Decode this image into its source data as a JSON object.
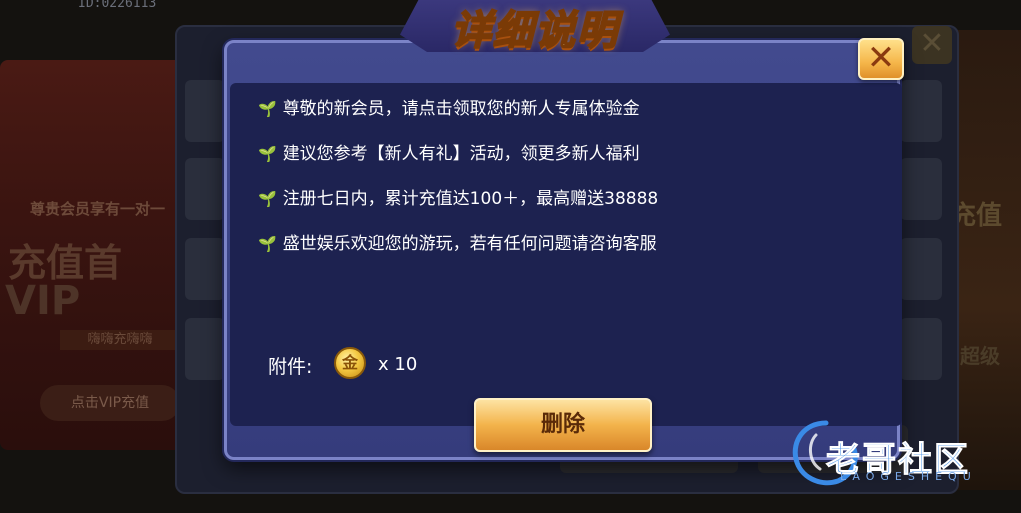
{
  "background": {
    "user_id": "ID:0226113",
    "left_tagline": "尊贵会员享有一对一",
    "left_title": "充值首",
    "left_vip": "VIP",
    "left_strip": "嗨嗨充嗨嗨",
    "left_button": "点击VIP充值",
    "right_text": "充值",
    "right_text2": "超级"
  },
  "dialog": {
    "title": "详细说明",
    "close_symbol": "✕",
    "lines": [
      "尊敬的新会员，请点击领取您的新人专属体验金",
      "建议您参考【新人有礼】活动，领更多新人福利",
      "注册七日内，累计充值达100＋，最高赠送38888",
      "盛世娱乐欢迎您的游玩，若有任何问题请咨询客服"
    ],
    "attachment_label": "附件:",
    "coin_symbol": "金",
    "quantity": "x 10",
    "delete_button": "删除"
  },
  "watermark": {
    "text": "老哥社区",
    "sub": "LAOGESHEQU"
  },
  "colors": {
    "dialog_bg": "#3a4386",
    "content_bg": "#1d2250",
    "accent_gold": "#f3b34b",
    "sprout_green": "#7ed957"
  }
}
